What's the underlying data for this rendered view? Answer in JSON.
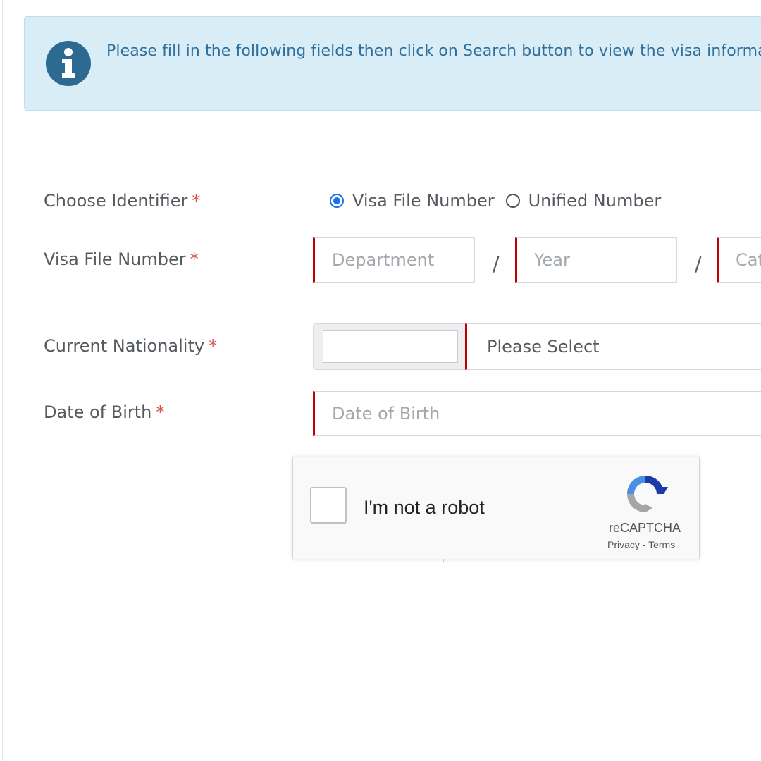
{
  "alert": {
    "icon": "info-icon",
    "text": "Please fill in the following fields then click on Search button to view the visa information",
    "background": "#d9edf7",
    "text_color": "#2f6f9c"
  },
  "form": {
    "required_marker": "*",
    "identifier": {
      "label": "Choose Identifier",
      "options": [
        {
          "label": "Visa File Number",
          "checked": true
        },
        {
          "label": "Unified Number",
          "checked": false
        }
      ]
    },
    "visa_file_number": {
      "label": "Visa File Number",
      "separator": "/",
      "department_placeholder": "Department",
      "year_placeholder": "Year",
      "category_placeholder": "Category"
    },
    "nationality": {
      "label": "Current Nationality",
      "code_value": "",
      "selected": "Please Select"
    },
    "date_of_birth": {
      "label": "Date of Birth",
      "placeholder": "Date of Birth"
    }
  },
  "recaptcha": {
    "label": "I'm not a robot",
    "brand": "reCAPTCHA",
    "privacy": "Privacy",
    "link_separator": " - ",
    "terms": "Terms"
  },
  "colors": {
    "required": "#d9534f",
    "field_accent": "#c00000",
    "radio_checked": "#1a73e8"
  }
}
